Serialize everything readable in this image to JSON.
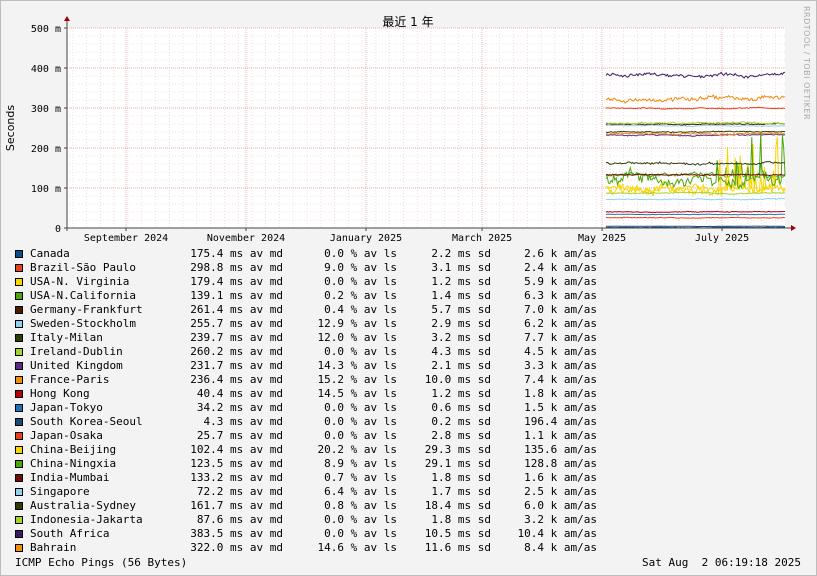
{
  "chart_data": {
    "type": "line",
    "title": "最近 1 年",
    "ylabel": "Seconds",
    "ylim": [
      0,
      0.5
    ],
    "yticks": [
      {
        "v": 0,
        "label": "0"
      },
      {
        "v": 0.1,
        "label": "100 m"
      },
      {
        "v": 0.2,
        "label": "200 m"
      },
      {
        "v": 0.3,
        "label": "300 m"
      },
      {
        "v": 0.4,
        "label": "400 m"
      },
      {
        "v": 0.5,
        "label": "500 m"
      }
    ],
    "xlim": [
      "2024-08-02",
      "2025-08-02"
    ],
    "xticks": [
      {
        "v": "2024-09-01",
        "label": "September 2024"
      },
      {
        "v": "2024-11-01",
        "label": "November 2024"
      },
      {
        "v": "2025-01-01",
        "label": "January 2025"
      },
      {
        "v": "2025-03-01",
        "label": "March 2025"
      },
      {
        "v": "2025-05-01",
        "label": "May 2025"
      },
      {
        "v": "2025-07-01",
        "label": "July 2025"
      }
    ],
    "data_start": "2025-05-03",
    "grid": true,
    "legend_position": "bottom",
    "series": [
      {
        "name": "Canada",
        "color": "#0b4f8a",
        "level": 0.0015,
        "noise": 0.001,
        "stats": {
          "avg": "175.4 ms av md",
          "loss": "0.0 % av ls",
          "sd": "2.2 ms sd",
          "am": "2.6 k am/as"
        }
      },
      {
        "name": "Brazil-São Paulo",
        "color": "#e8401c",
        "level": 0.3,
        "noise": 0.002,
        "stats": {
          "avg": "298.8 ms av md",
          "loss": "9.0 % av ls",
          "sd": "3.1 ms sd",
          "am": "2.4 k am/as"
        }
      },
      {
        "name": "USA-N. Virginia",
        "color": "#f7d600",
        "level": 0.098,
        "noise": 0.012,
        "spiky": true,
        "stats": {
          "avg": "179.4 ms av md",
          "loss": "0.0 % av ls",
          "sd": "1.2 ms sd",
          "am": "5.9 k am/as"
        }
      },
      {
        "name": "USA-N.California",
        "color": "#4da60c",
        "level": 0.132,
        "noise": 0.006,
        "spiky": true,
        "stats": {
          "avg": "139.1 ms av md",
          "loss": "0.2 % av ls",
          "sd": "1.4 ms sd",
          "am": "6.3 k am/as"
        }
      },
      {
        "name": "Germany-Frankfurt",
        "color": "#4a1d00",
        "level": 0.26,
        "noise": 0.002,
        "stats": {
          "avg": "261.4 ms av md",
          "loss": "0.4 % av ls",
          "sd": "5.7 ms sd",
          "am": "7.0 k am/as"
        }
      },
      {
        "name": "Sweden-Stockholm",
        "color": "#8ed1f0",
        "level": 0.256,
        "noise": 0.002,
        "stats": {
          "avg": "255.7 ms av md",
          "loss": "12.9 % av ls",
          "sd": "2.9 ms sd",
          "am": "6.2 k am/as"
        }
      },
      {
        "name": "Italy-Milan",
        "color": "#2f3d08",
        "level": 0.24,
        "noise": 0.002,
        "stats": {
          "avg": "239.7 ms av md",
          "loss": "12.0 % av ls",
          "sd": "3.2 ms sd",
          "am": "7.7 k am/as"
        }
      },
      {
        "name": "Ireland-Dublin",
        "color": "#a5d22b",
        "level": 0.262,
        "noise": 0.003,
        "stats": {
          "avg": "260.2 ms av md",
          "loss": "0.0 % av ls",
          "sd": "4.3 ms sd",
          "am": "4.5 k am/as"
        }
      },
      {
        "name": "United Kingdom",
        "color": "#5c2b8a",
        "level": 0.232,
        "noise": 0.002,
        "stats": {
          "avg": "231.7 ms av md",
          "loss": "14.3 % av ls",
          "sd": "2.1 ms sd",
          "am": "3.3 k am/as"
        }
      },
      {
        "name": "France-Paris",
        "color": "#f58a0b",
        "level": 0.236,
        "noise": 0.003,
        "stats": {
          "avg": "236.4 ms av md",
          "loss": "15.2 % av ls",
          "sd": "10.0 ms sd",
          "am": "7.4 k am/as"
        }
      },
      {
        "name": "Hong Kong",
        "color": "#b5000c",
        "level": 0.04,
        "noise": 0.0015,
        "stats": {
          "avg": "40.4 ms av md",
          "loss": "14.5 % av ls",
          "sd": "1.2 ms sd",
          "am": "1.8 k am/as"
        }
      },
      {
        "name": "Japan-Tokyo",
        "color": "#1c73b8",
        "level": 0.034,
        "noise": 0.001,
        "stats": {
          "avg": "34.2 ms av md",
          "loss": "0.0 % av ls",
          "sd": "0.6 ms sd",
          "am": "1.5 k am/as"
        }
      },
      {
        "name": "South Korea-Seoul",
        "color": "#1b4a7a",
        "level": 0.0043,
        "noise": 0.0005,
        "stats": {
          "avg": "4.3 ms av md",
          "loss": "0.0 % av ls",
          "sd": "0.2 ms sd",
          "am": "196.4 am/as"
        }
      },
      {
        "name": "Japan-Osaka",
        "color": "#e8401c",
        "level": 0.0257,
        "noise": 0.0015,
        "stats": {
          "avg": "25.7 ms av md",
          "loss": "0.0 % av ls",
          "sd": "2.8 ms sd",
          "am": "1.1 k am/as"
        }
      },
      {
        "name": "China-Beijing",
        "color": "#f7d600",
        "level": 0.102,
        "noise": 0.02,
        "spiky": true,
        "stats": {
          "avg": "102.4 ms av md",
          "loss": "20.2 % av ls",
          "sd": "29.3 ms sd",
          "am": "135.6 am/as"
        }
      },
      {
        "name": "China-Ningxia",
        "color": "#4da60c",
        "level": 0.123,
        "noise": 0.02,
        "spiky": true,
        "stats": {
          "avg": "123.5 ms av md",
          "loss": "8.9 % av ls",
          "sd": "29.1 ms sd",
          "am": "128.8 am/as"
        }
      },
      {
        "name": "India-Mumbai",
        "color": "#6e0b0b",
        "level": 0.133,
        "noise": 0.002,
        "stats": {
          "avg": "133.2 ms av md",
          "loss": "0.7 % av ls",
          "sd": "1.8 ms sd",
          "am": "1.6 k am/as"
        }
      },
      {
        "name": "Singapore",
        "color": "#8ed1f0",
        "level": 0.072,
        "noise": 0.002,
        "stats": {
          "avg": "72.2 ms av md",
          "loss": "6.4 % av ls",
          "sd": "1.7 ms sd",
          "am": "2.5 k am/as"
        }
      },
      {
        "name": "Australia-Sydney",
        "color": "#2f3d08",
        "level": 0.162,
        "noise": 0.004,
        "stats": {
          "avg": "161.7 ms av md",
          "loss": "0.8 % av ls",
          "sd": "18.4 ms sd",
          "am": "6.0 k am/as"
        }
      },
      {
        "name": "Indonesia-Jakarta",
        "color": "#a5d22b",
        "level": 0.0876,
        "noise": 0.002,
        "stats": {
          "avg": "87.6 ms av md",
          "loss": "0.0 % av ls",
          "sd": "1.8 ms sd",
          "am": "3.2 k am/as"
        }
      },
      {
        "name": "South Africa",
        "color": "#3b1a66",
        "level": 0.383,
        "noise": 0.006,
        "stats": {
          "avg": "383.5 ms av md",
          "loss": "0.0 % av ls",
          "sd": "10.5 ms sd",
          "am": "10.4 k am/as"
        }
      },
      {
        "name": "Bahrain",
        "color": "#f58a0b",
        "level": 0.322,
        "noise": 0.008,
        "stats": {
          "avg": "322.0 ms av md",
          "loss": "14.6 % av ls",
          "sd": "11.6 ms sd",
          "am": "8.4 k am/as"
        }
      }
    ]
  },
  "footer": {
    "left": "ICMP Echo Pings (56 Bytes)",
    "right": "Sat Aug  2 06:19:18 2025"
  },
  "watermark": "RRDTOOL / TOBI OETIKER"
}
